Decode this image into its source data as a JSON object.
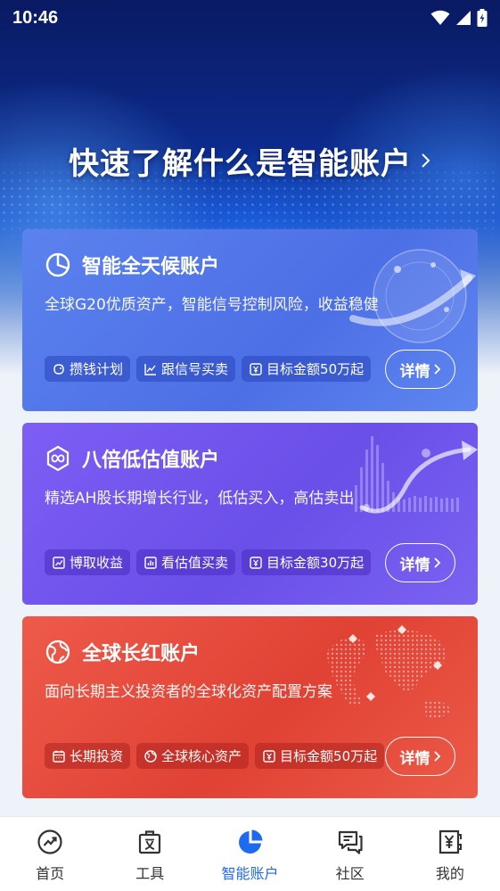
{
  "status_bar": {
    "time": "10:46"
  },
  "hero": {
    "title": "快速了解什么是智能账户"
  },
  "cards": [
    {
      "title": "智能全天候账户",
      "description": "全球G20优质资产，智能信号控制风险，收益稳健",
      "tags": [
        "攒钱计划",
        "跟信号买卖",
        "目标金额50万起"
      ],
      "button": "详情",
      "icon": "pie-chart-icon"
    },
    {
      "title": "八倍低估值账户",
      "description": "精选AH股长期增长行业，低估买入，高估卖出",
      "tags": [
        "博取收益",
        "看估值买卖",
        "目标金额30万起"
      ],
      "button": "详情",
      "icon": "infinity-hexagon-icon"
    },
    {
      "title": "全球长红账户",
      "description": "面向长期主义投资者的全球化资产配置方案",
      "tags": [
        "长期投资",
        "全球核心资产",
        "目标金额50万起"
      ],
      "button": "详情",
      "icon": "globe-icon"
    }
  ],
  "tabbar": {
    "items": [
      {
        "label": "首页",
        "icon": "trend-circle-icon"
      },
      {
        "label": "工具",
        "icon": "toolbox-icon"
      },
      {
        "label": "智能账户",
        "icon": "pie-chart-icon",
        "active": true
      },
      {
        "label": "社区",
        "icon": "chat-icon"
      },
      {
        "label": "我的",
        "icon": "yen-wallet-icon"
      }
    ]
  },
  "colors": {
    "card_1": "#5374ea",
    "card_2": "#7154ee",
    "card_3": "#e5493a",
    "tab_active": "#1f6bf0"
  }
}
